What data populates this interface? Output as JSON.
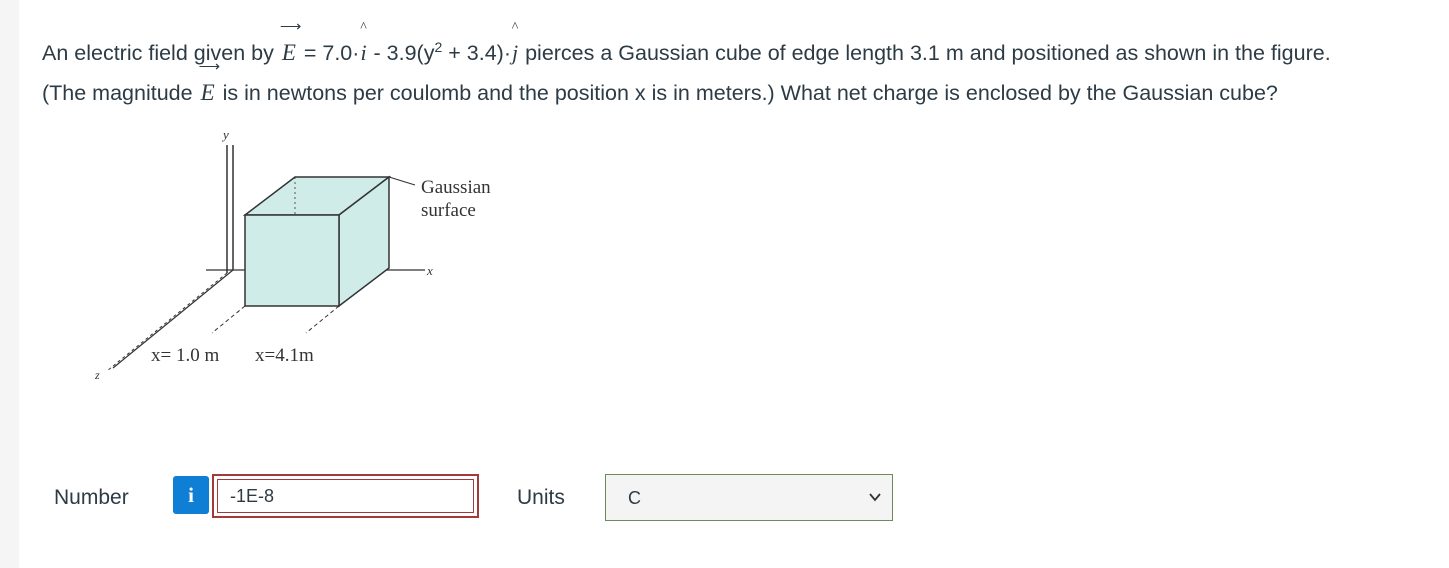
{
  "question": {
    "p1": "An electric field given by ",
    "e_symbol": "E",
    "p2": " = 7.0·",
    "i_symbol": "i",
    "p3": " - 3.9(y",
    "sq": "2",
    "p4": " + 3.4)·",
    "j_symbol": "j",
    "p5": " pierces a Gaussian cube of edge length 3.1 m and positioned as shown in the figure.",
    "p6": "(The magnitude ",
    "e_symbol2": "E",
    "p7": " is in newtons per coulomb and the position x is in meters.) What net charge is enclosed by the Gaussian cube?"
  },
  "figure": {
    "y_label": "y",
    "x_label": "x",
    "z_label": "z",
    "surface_label_1": "Gaussian",
    "surface_label_2": "surface",
    "x1_label": "x= 1.0 m",
    "x2_label": "x=4.1m"
  },
  "answer": {
    "number_label": "Number",
    "info_icon": "i",
    "number_value": "-1E-8",
    "units_label": "Units",
    "units_value": "C"
  },
  "colors": {
    "cube_fill": "#cfece8",
    "info_blue": "#0f7fd5",
    "input_border": "#a33a3a",
    "select_border": "#6b8b5b"
  }
}
